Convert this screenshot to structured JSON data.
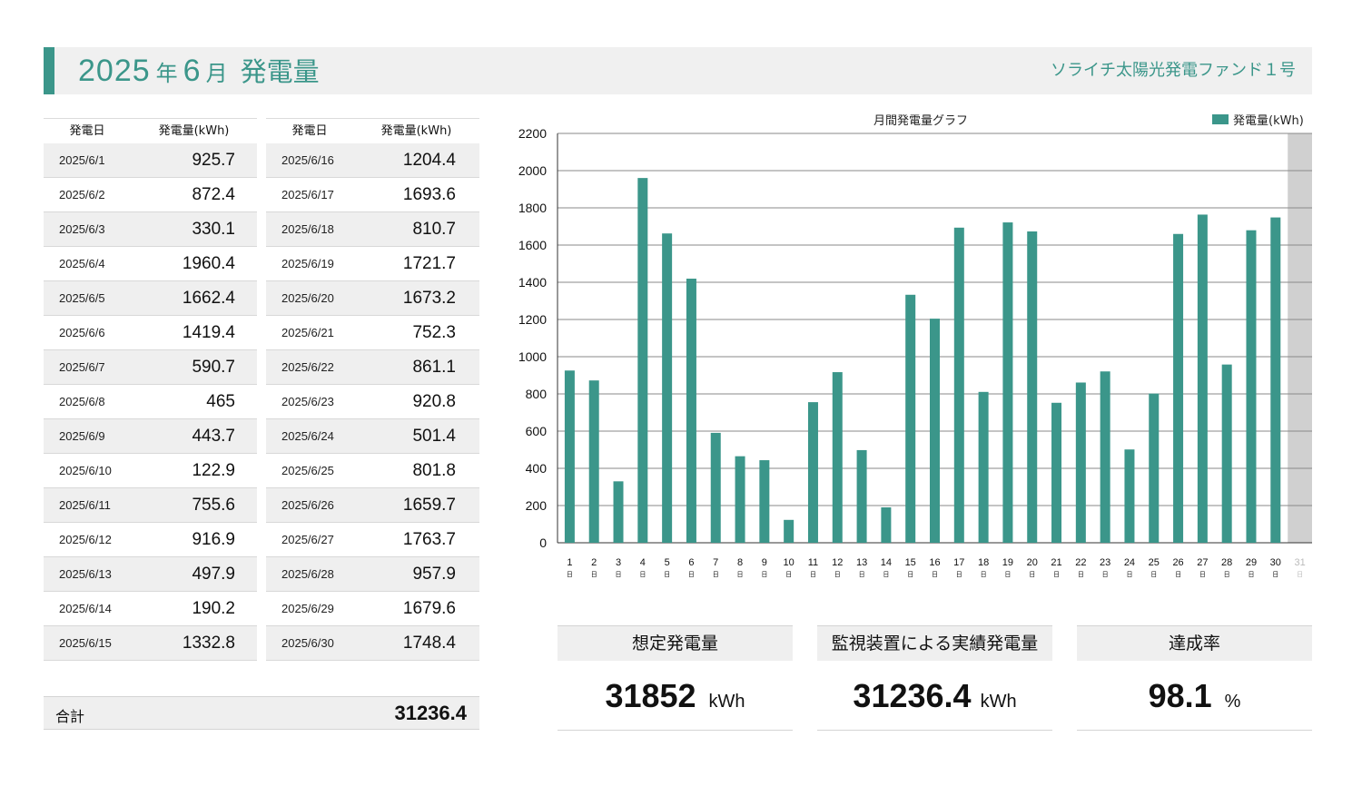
{
  "header": {
    "year": "2025",
    "year_unit": "年",
    "month": "6",
    "month_unit": "月",
    "label": "発電量",
    "fund_name": "ソライチ太陽光発電ファンド１号"
  },
  "table": {
    "col_date": "発電日",
    "col_value": "発電量(kWh)",
    "left_rows": [
      {
        "date": "2025/6/1",
        "value": "925.7"
      },
      {
        "date": "2025/6/2",
        "value": "872.4"
      },
      {
        "date": "2025/6/3",
        "value": "330.1"
      },
      {
        "date": "2025/6/4",
        "value": "1960.4"
      },
      {
        "date": "2025/6/5",
        "value": "1662.4"
      },
      {
        "date": "2025/6/6",
        "value": "1419.4"
      },
      {
        "date": "2025/6/7",
        "value": "590.7"
      },
      {
        "date": "2025/6/8",
        "value": "465"
      },
      {
        "date": "2025/6/9",
        "value": "443.7"
      },
      {
        "date": "2025/6/10",
        "value": "122.9"
      },
      {
        "date": "2025/6/11",
        "value": "755.6"
      },
      {
        "date": "2025/6/12",
        "value": "916.9"
      },
      {
        "date": "2025/6/13",
        "value": "497.9"
      },
      {
        "date": "2025/6/14",
        "value": "190.2"
      },
      {
        "date": "2025/6/15",
        "value": "1332.8"
      }
    ],
    "right_rows": [
      {
        "date": "2025/6/16",
        "value": "1204.4"
      },
      {
        "date": "2025/6/17",
        "value": "1693.6"
      },
      {
        "date": "2025/6/18",
        "value": "810.7"
      },
      {
        "date": "2025/6/19",
        "value": "1721.7"
      },
      {
        "date": "2025/6/20",
        "value": "1673.2"
      },
      {
        "date": "2025/6/21",
        "value": "752.3"
      },
      {
        "date": "2025/6/22",
        "value": "861.1"
      },
      {
        "date": "2025/6/23",
        "value": "920.8"
      },
      {
        "date": "2025/6/24",
        "value": "501.4"
      },
      {
        "date": "2025/6/25",
        "value": "801.8"
      },
      {
        "date": "2025/6/26",
        "value": "1659.7"
      },
      {
        "date": "2025/6/27",
        "value": "1763.7"
      },
      {
        "date": "2025/6/28",
        "value": "957.9"
      },
      {
        "date": "2025/6/29",
        "value": "1679.6"
      },
      {
        "date": "2025/6/30",
        "value": "1748.4"
      }
    ],
    "total_label": "合計",
    "total_value": "31236.4"
  },
  "kpis": [
    {
      "title": "想定発電量",
      "value": "31852",
      "unit": "kWh"
    },
    {
      "title": "監視装置による実績発電量",
      "value": "31236.4",
      "unit": "kWh"
    },
    {
      "title": "達成率",
      "value": "98.1",
      "unit": "%"
    }
  ],
  "colors": {
    "accent": "#3b968a",
    "bar": "#3b968a",
    "inactive_day": "#d0d0d0"
  },
  "chart_data": {
    "type": "bar",
    "title": "月間発電量グラフ",
    "legend": [
      "発電量(kWh)"
    ],
    "legend_position": "top-right",
    "grid": true,
    "ylim": [
      0,
      2200
    ],
    "yticks": [
      0,
      200,
      400,
      600,
      800,
      1000,
      1200,
      1400,
      1600,
      1800,
      2000,
      2200
    ],
    "categories": [
      "1",
      "2",
      "3",
      "4",
      "5",
      "6",
      "7",
      "8",
      "9",
      "10",
      "11",
      "12",
      "13",
      "14",
      "15",
      "16",
      "17",
      "18",
      "19",
      "20",
      "21",
      "22",
      "23",
      "24",
      "25",
      "26",
      "27",
      "28",
      "29",
      "30",
      "31"
    ],
    "category_suffix": "日",
    "series": [
      {
        "name": "発電量(kWh)",
        "values": [
          925.7,
          872.4,
          330.1,
          1960.4,
          1662.4,
          1419.4,
          590.7,
          465,
          443.7,
          122.9,
          755.6,
          916.9,
          497.9,
          190.2,
          1332.8,
          1204.4,
          1693.6,
          810.7,
          1721.7,
          1673.2,
          752.3,
          861.1,
          920.8,
          501.4,
          801.8,
          1659.7,
          1763.7,
          957.9,
          1679.6,
          1748.4,
          null
        ]
      }
    ],
    "inactive_categories": [
      "31"
    ]
  }
}
